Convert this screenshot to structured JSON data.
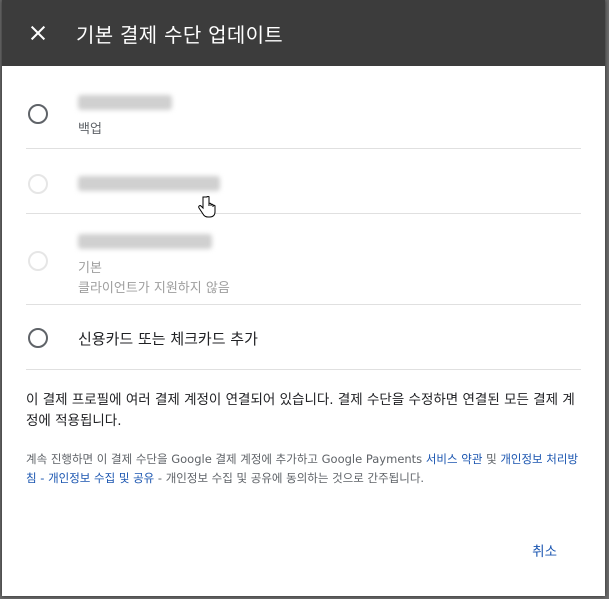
{
  "header": {
    "title": "기본 결제 수단 업데이트",
    "close_icon": "close-icon"
  },
  "options": [
    {
      "sub": "백업",
      "disabled": false,
      "selected": false
    },
    {
      "disabled": true,
      "selected": false
    },
    {
      "sub1": "기본",
      "sub2": "클라이언트가 지원하지 않음",
      "disabled": true,
      "selected": false
    },
    {
      "label": "신용카드 또는 체크카드 추가",
      "disabled": false,
      "selected": false
    }
  ],
  "notice": "이 결제 프로필에 여러 결제 계정이 연결되어 있습니다. 결제 수단을 수정하면 연결된 모든 결제 계정에 적용됩니다.",
  "legal": {
    "prefix": "계속 진행하면 이 결제 수단을 Google 결제 계정에 추가하고 Google Payments",
    "link1": "서비스 약관",
    "and": "및",
    "link2": "개인정보 처리방침",
    "dash": "-",
    "link3": "개인정보 수집 및 공유",
    "suffix": "- 개인정보 수집 및 공유에 동의하는 것으로 간주됩니다."
  },
  "footer": {
    "cancel_label": "취소"
  },
  "colors": {
    "header_bg": "#3c3c3c",
    "link": "#1a55b0"
  }
}
